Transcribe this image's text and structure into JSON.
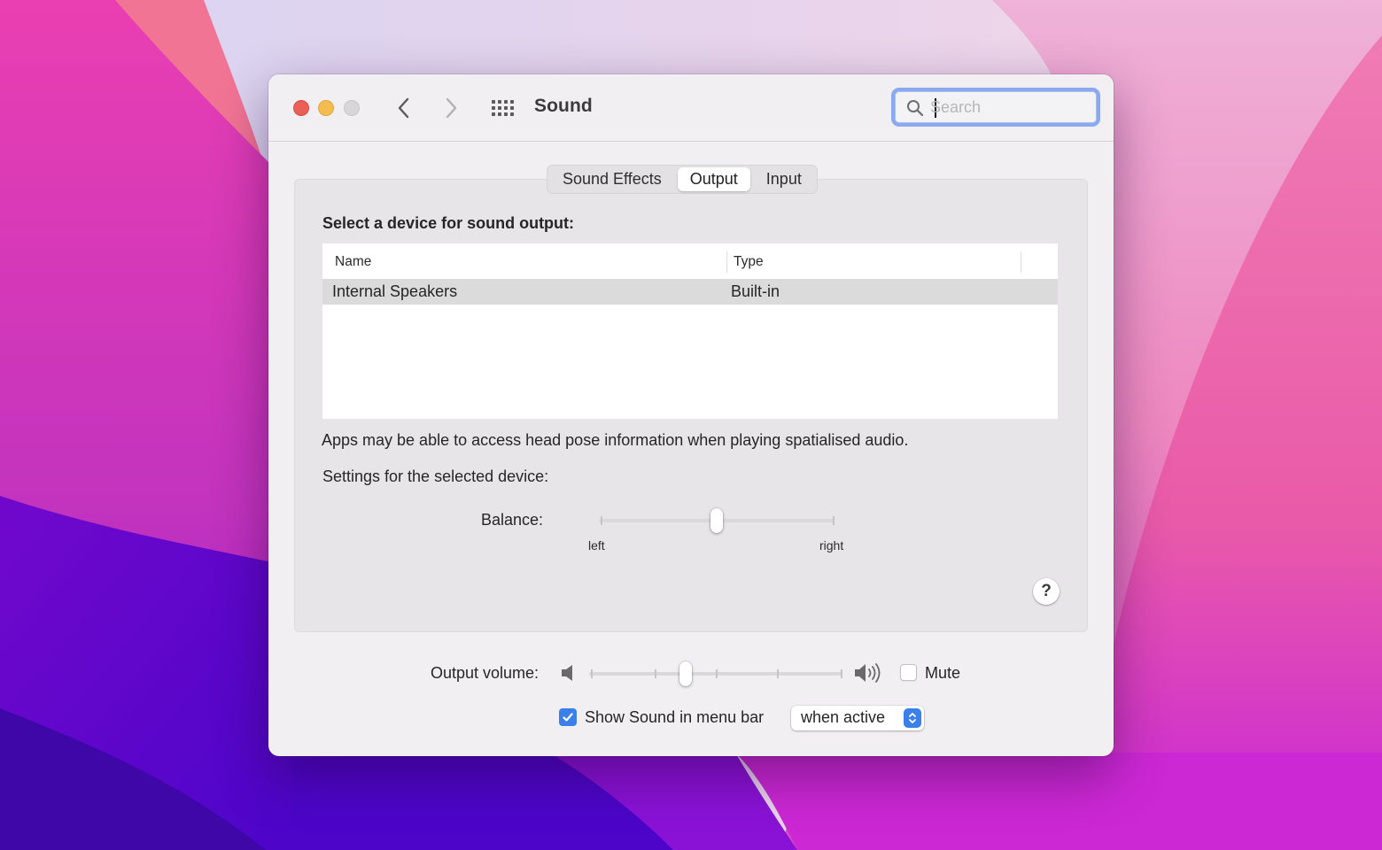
{
  "window": {
    "title": "Sound",
    "search": {
      "placeholder": "Search",
      "value": ""
    }
  },
  "icons": {
    "close": "close-traffic-light",
    "minimize": "minimize-traffic-light",
    "zoom": "zoom-traffic-light",
    "back": "chevron-left-icon",
    "forward": "chevron-right-icon",
    "show_all": "grid-icon",
    "search": "magnifier-icon",
    "help": "question-mark-icon",
    "volume_low": "speaker-low-icon",
    "volume_high": "speaker-high-icon"
  },
  "tabs": [
    {
      "label": "Sound Effects",
      "active": false
    },
    {
      "label": "Output",
      "active": true
    },
    {
      "label": "Input",
      "active": false
    }
  ],
  "output": {
    "section_title": "Select a device for sound output:",
    "table": {
      "columns": [
        "Name",
        "Type"
      ],
      "rows": [
        {
          "name": "Internal Speakers",
          "type": "Built-in",
          "selected": true
        }
      ]
    },
    "note": "Apps may be able to access head pose information when playing spatialised audio.",
    "settings_label": "Settings for the selected device:",
    "balance": {
      "label": "Balance:",
      "left_label": "left",
      "right_label": "right",
      "value_percent": 50
    },
    "help_label": "?"
  },
  "bottom": {
    "volume": {
      "label": "Output volume:",
      "value_percent": 38
    },
    "mute": {
      "label": "Mute",
      "checked": false
    },
    "menu_bar": {
      "label": "Show Sound in menu bar",
      "checked": true,
      "popup_value": "when active"
    }
  },
  "colors": {
    "accent": "#3b7fe8",
    "search_focus_ring": "#8aa9ee",
    "close": "#ea5f56",
    "minimize": "#f3be4f",
    "zoom_disabled": "#d8d6d9",
    "window_bg": "#f1eff2",
    "panel_bg": "#e7e5e8",
    "selected_row": "#dcdbdc"
  }
}
